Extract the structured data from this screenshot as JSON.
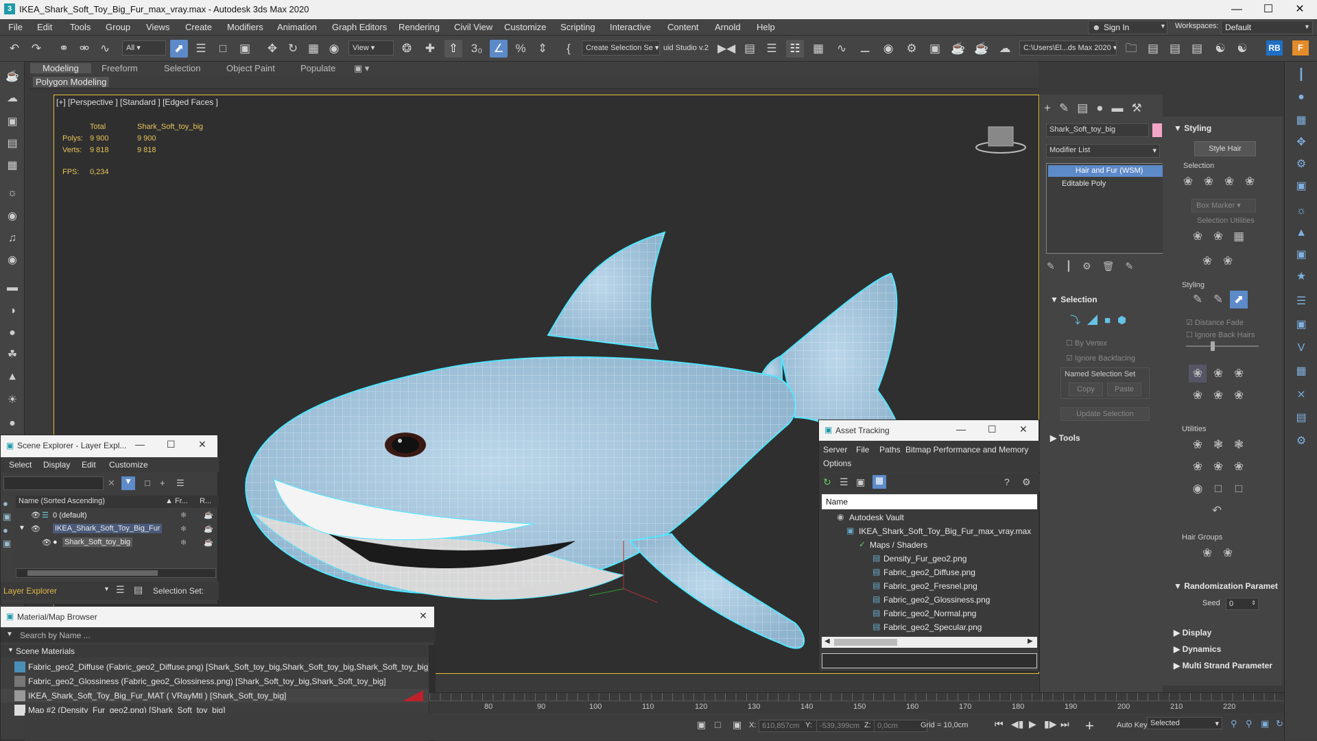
{
  "window": {
    "title": "IKEA_Shark_Soft_Toy_Big_Fur_max_vray.max - Autodesk 3ds Max 2020"
  },
  "menu": [
    "File",
    "Edit",
    "Tools",
    "Group",
    "Views",
    "Create",
    "Modifiers",
    "Animation",
    "Graph Editors",
    "Rendering",
    "Civil View",
    "Customize",
    "Scripting",
    "Interactive",
    "Content",
    "Arnold",
    "Help"
  ],
  "account": {
    "sign_in": "Sign In",
    "workspaces_label": "Workspaces:",
    "workspace": "Default"
  },
  "toolbar": {
    "filter": "All",
    "ref_coord": "View",
    "selection_set": "Create Selection Se",
    "studio": "uid Studio v.2",
    "project_path": "C:\\Users\\El...ds Max 2020",
    "rb_badge": "RB"
  },
  "ribbon": {
    "tabs": [
      "Modeling",
      "Freeform",
      "Selection",
      "Object Paint",
      "Populate"
    ],
    "sub": "Polygon Modeling"
  },
  "viewport": {
    "label": "[+] [Perspective ] [Standard ] [Edged Faces ]",
    "stats": {
      "total_label": "Total",
      "object_label": "Shark_Soft_toy_big",
      "polys_label": "Polys:",
      "polys_total": "9 900",
      "polys_obj": "9 900",
      "verts_label": "Verts:",
      "verts_total": "9 818",
      "verts_obj": "9 818",
      "fps_label": "FPS:",
      "fps": "0,234"
    }
  },
  "command_panel": {
    "object_name": "Shark_Soft_toy_big",
    "object_color": "#f4a6c8",
    "modifier_list": "Modifier List",
    "stack": [
      "Hair and Fur (WSM)",
      "Editable Poly"
    ],
    "selection_title": "Selection",
    "by_vertex": "By Vertex",
    "ignore_backfacing": "Ignore Backfacing",
    "named_selection_set": "Named Selection Set",
    "copy": "Copy",
    "paste": "Paste",
    "update_selection": "Update Selection",
    "tools": "Tools"
  },
  "hair_panel": {
    "styling_title": "Styling",
    "style_hair": "Style Hair",
    "selection_label": "Selection",
    "box_marker": "Box Marker",
    "selection_utilities": "Selection Utilities",
    "styling_label": "Styling",
    "distance_fade": "Distance Fade",
    "ignore_back_hairs": "Ignore Back Hairs",
    "utilities_label": "Utilities",
    "hair_groups_label": "Hair Groups",
    "randomization": "Randomization Paramet",
    "seed_label": "Seed",
    "seed": "0",
    "display": "Display",
    "dynamics": "Dynamics",
    "multi_strand": "Multi Strand Parameter"
  },
  "scene_explorer": {
    "title": "Scene Explorer - Layer Expl...",
    "menu": [
      "Select",
      "Display",
      "Edit",
      "Customize"
    ],
    "col_name": "Name (Sorted Ascending)",
    "col_fr": "▲ Fr...",
    "col_r": "R...",
    "rows": [
      "0 (default)",
      "IKEA_Shark_Soft_Toy_Big_Fur",
      "Shark_Soft_toy_big"
    ],
    "footer_dropdown": "Layer Explorer",
    "footer_selection_set": "Selection Set:"
  },
  "material_browser": {
    "title": "Material/Map Browser",
    "search": "Search by Name ...",
    "section": "Scene Materials",
    "items": [
      "Fabric_geo2_Diffuse (Fabric_geo2_Diffuse.png) [Shark_Soft_toy_big,Shark_Soft_toy_big,Shark_Soft_toy_big]",
      "Fabric_geo2_Glossiness (Fabric_geo2_Glossiness.png) [Shark_Soft_toy_big,Shark_Soft_toy_big]",
      "IKEA_Shark_Soft_Toy_Big_Fur_MAT ( VRayMtl ) [Shark_Soft_toy_big]",
      "Map #2 (Density_Fur_geo2.png) [Shark_Soft_toy_big]"
    ]
  },
  "asset_tracking": {
    "title": "Asset Tracking",
    "menu": [
      "Server",
      "File",
      "Paths",
      "Bitmap Performance and Memory"
    ],
    "options": "Options",
    "col_name": "Name",
    "rows": [
      "Autodesk Vault",
      "IKEA_Shark_Soft_Toy_Big_Fur_max_vray.max",
      "Maps / Shaders",
      "Density_Fur_geo2.png",
      "Fabric_geo2_Diffuse.png",
      "Fabric_geo2_Fresnel.png",
      "Fabric_geo2_Glossiness.png",
      "Fabric_geo2_Normal.png",
      "Fabric_geo2_Specular.png"
    ]
  },
  "timeline": {
    "ticks": [
      "80",
      "90",
      "100",
      "110",
      "120",
      "130",
      "140",
      "150",
      "160",
      "170",
      "180",
      "190",
      "200",
      "210",
      "220"
    ]
  },
  "status": {
    "x_label": "X:",
    "x": "610,857cm",
    "y_label": "Y:",
    "y": "-539,399cm",
    "z_label": "Z:",
    "z": "0,0cm",
    "grid": "Grid = 10,0cm",
    "auto_key": "Auto Key",
    "key_mode": "Selected"
  }
}
